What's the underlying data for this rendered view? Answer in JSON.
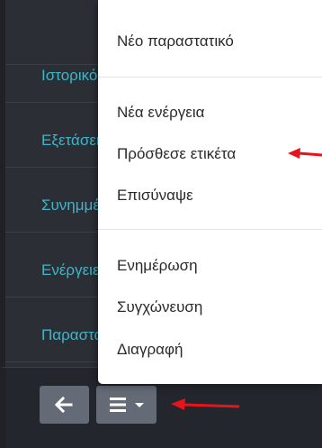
{
  "side_nav": {
    "items": [
      {
        "label": "Ιστορικό"
      },
      {
        "label": "Εξετάσεις"
      },
      {
        "label": "Συνημμένα"
      },
      {
        "label": "Ενέργειες"
      },
      {
        "label": "Παραστατικά"
      }
    ]
  },
  "dropdown_menu": {
    "new_document": "Νέο παραστατικό",
    "new_action": "Νέα ενέργεια",
    "add_tag": "Πρόσθεσε ετικέτα",
    "attach": "Επισύναψε",
    "update": "Ενημέρωση",
    "merge": "Συγχώνευση",
    "delete": "Διαγραφή"
  },
  "toolbar": {
    "back_icon": "arrow-left-icon",
    "menu_icon": "hamburger-icon",
    "caret_icon": "caret-down-icon"
  },
  "colors": {
    "nav_text": "#3fb6c8",
    "panel_bg": "#2b2e35",
    "button_bg": "#646b76",
    "annotation_arrow": "#e8141b"
  }
}
